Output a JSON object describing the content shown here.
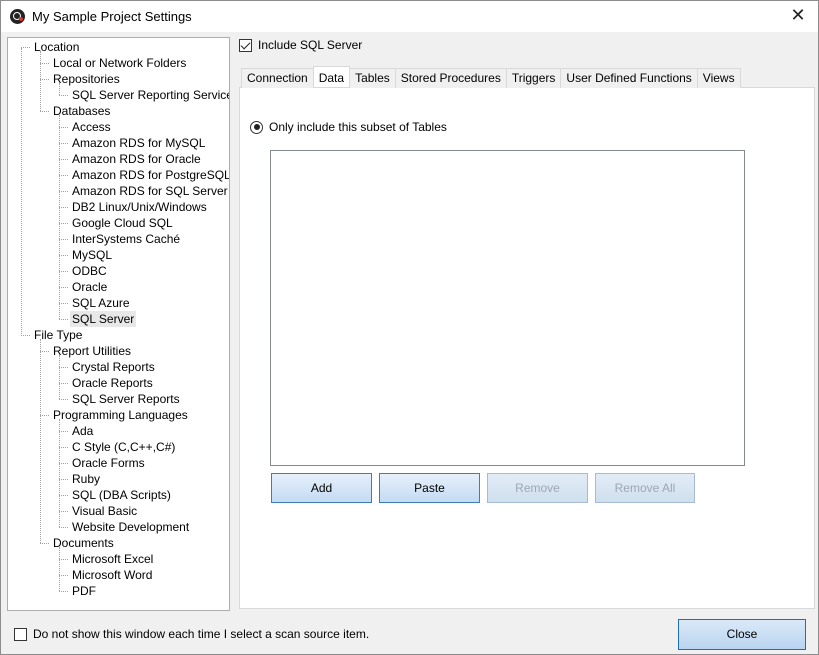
{
  "window": {
    "title": "My Sample Project Settings"
  },
  "tree": [
    {
      "label": "Location",
      "level": 0
    },
    {
      "label": "Local or Network Folders",
      "level": 1
    },
    {
      "label": "Repositories",
      "level": 1
    },
    {
      "label": "SQL Server Reporting Services",
      "level": 2
    },
    {
      "label": "Databases",
      "level": 1
    },
    {
      "label": "Access",
      "level": 2
    },
    {
      "label": "Amazon RDS for MySQL",
      "level": 2
    },
    {
      "label": "Amazon RDS for Oracle",
      "level": 2
    },
    {
      "label": "Amazon RDS for PostgreSQL",
      "level": 2
    },
    {
      "label": "Amazon RDS for SQL Server",
      "level": 2
    },
    {
      "label": "DB2 Linux/Unix/Windows",
      "level": 2
    },
    {
      "label": "Google Cloud SQL",
      "level": 2
    },
    {
      "label": "InterSystems Caché",
      "level": 2
    },
    {
      "label": "MySQL",
      "level": 2
    },
    {
      "label": "ODBC",
      "level": 2
    },
    {
      "label": "Oracle",
      "level": 2
    },
    {
      "label": "SQL Azure",
      "level": 2
    },
    {
      "label": "SQL Server",
      "level": 2,
      "selected": true
    },
    {
      "label": "File Type",
      "level": 0
    },
    {
      "label": "Report Utilities",
      "level": 1
    },
    {
      "label": "Crystal Reports",
      "level": 2
    },
    {
      "label": "Oracle Reports",
      "level": 2
    },
    {
      "label": "SQL Server Reports",
      "level": 2
    },
    {
      "label": "Programming Languages",
      "level": 1
    },
    {
      "label": "Ada",
      "level": 2
    },
    {
      "label": "C Style (C,C++,C#)",
      "level": 2
    },
    {
      "label": "Oracle Forms",
      "level": 2
    },
    {
      "label": "Ruby",
      "level": 2
    },
    {
      "label": "SQL (DBA Scripts)",
      "level": 2
    },
    {
      "label": "Visual Basic",
      "level": 2
    },
    {
      "label": "Website Development",
      "level": 2
    },
    {
      "label": "Documents",
      "level": 1
    },
    {
      "label": "Microsoft Excel",
      "level": 2
    },
    {
      "label": "Microsoft Word",
      "level": 2
    },
    {
      "label": "PDF",
      "level": 2
    }
  ],
  "include_sql_server": {
    "label": "Include SQL Server",
    "checked": true
  },
  "tabs": [
    {
      "label": "Connection",
      "active": false
    },
    {
      "label": "Data",
      "active": true
    },
    {
      "label": "Tables",
      "active": false
    },
    {
      "label": "Stored Procedures",
      "active": false
    },
    {
      "label": "Triggers",
      "active": false
    },
    {
      "label": "User Defined Functions",
      "active": false
    },
    {
      "label": "Views",
      "active": false
    }
  ],
  "data_tab": {
    "radio_label": "Only include this subset of Tables",
    "radio_selected": true,
    "table_items": [],
    "buttons": {
      "add": "Add",
      "paste": "Paste",
      "remove": "Remove",
      "remove_all": "Remove All"
    }
  },
  "footer": {
    "dont_show_label": "Do not show this window each time I select a scan source item.",
    "dont_show_checked": false,
    "close_label": "Close"
  }
}
